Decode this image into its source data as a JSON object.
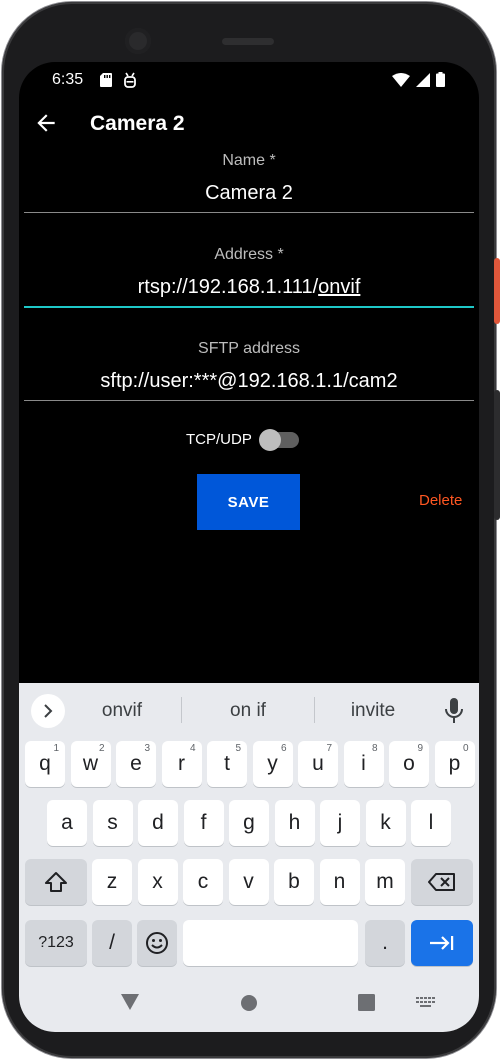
{
  "status_bar": {
    "time": "6:35"
  },
  "app_bar": {
    "title": "Camera 2"
  },
  "form": {
    "name": {
      "label": "Name *",
      "value": "Camera 2"
    },
    "address": {
      "label": "Address *",
      "value_prefix": "rtsp://192.168.1.111/",
      "value_underlined": "onvif"
    },
    "sftp": {
      "label": "SFTP address",
      "value": "sftp://user:***@192.168.1.1/cam2"
    },
    "toggle": {
      "label": "TCP/UDP",
      "on": false
    },
    "save_label": "SAVE",
    "delete_label": "Delete"
  },
  "colors": {
    "accent_line": "#1ec8c8",
    "save_button": "#0057d9",
    "delete": "#ff5722"
  },
  "keyboard": {
    "suggestions": [
      "onvif",
      "on if",
      "invite"
    ],
    "row1": [
      {
        "k": "q",
        "n": "1"
      },
      {
        "k": "w",
        "n": "2"
      },
      {
        "k": "e",
        "n": "3"
      },
      {
        "k": "r",
        "n": "4"
      },
      {
        "k": "t",
        "n": "5"
      },
      {
        "k": "y",
        "n": "6"
      },
      {
        "k": "u",
        "n": "7"
      },
      {
        "k": "i",
        "n": "8"
      },
      {
        "k": "o",
        "n": "9"
      },
      {
        "k": "p",
        "n": "0"
      }
    ],
    "row2": [
      "a",
      "s",
      "d",
      "f",
      "g",
      "h",
      "j",
      "k",
      "l"
    ],
    "row3": [
      "z",
      "x",
      "c",
      "v",
      "b",
      "n",
      "m"
    ],
    "symbols_label": "?123",
    "slash_label": "/",
    "period_label": "."
  }
}
